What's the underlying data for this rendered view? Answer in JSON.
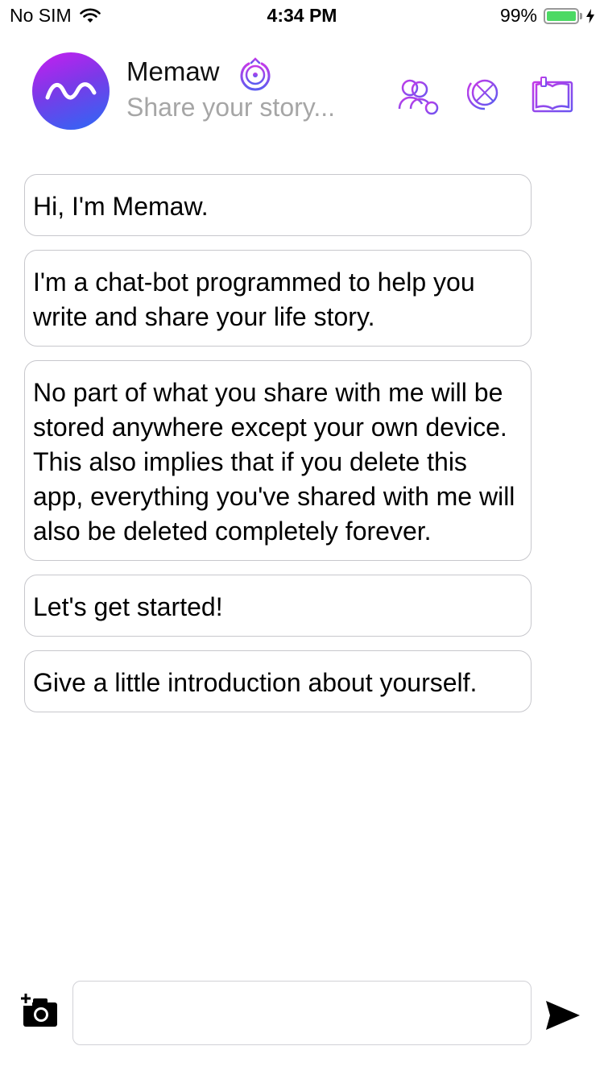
{
  "status_bar": {
    "carrier": "No SIM",
    "time": "4:34 PM",
    "battery_percent": "99%",
    "battery_level": 0.99,
    "wifi_icon": "wifi-icon",
    "charging_icon": "bolt-icon"
  },
  "header": {
    "title": "Memaw",
    "subtitle": "Share your story...",
    "avatar_icon": "wave-logo-icon",
    "title_icon": "power-icon",
    "actions": [
      "people-add-icon",
      "globe-icon",
      "book-icon"
    ]
  },
  "messages": [
    {
      "text": "Hi, I'm Memaw."
    },
    {
      "text": "I'm a chat-bot programmed to help you write and share your life story."
    },
    {
      "text": "No part of what you share with me will be stored anywhere except your own device. This also implies that if you delete this app, everything you've shared with me will also be deleted completely forever."
    },
    {
      "text": "Let's get started!"
    },
    {
      "text": "Give a little introduction about yourself."
    }
  ],
  "composer": {
    "input_value": "",
    "input_placeholder": "",
    "camera_icon": "add-photo-icon",
    "send_icon": "send-icon"
  },
  "colors": {
    "accent_purple": "#b43be6",
    "accent_blue": "#2a6af5",
    "bubble_border": "#c7c7cc",
    "subtitle_gray": "#a6a6a6",
    "battery_green": "#4cd964"
  }
}
